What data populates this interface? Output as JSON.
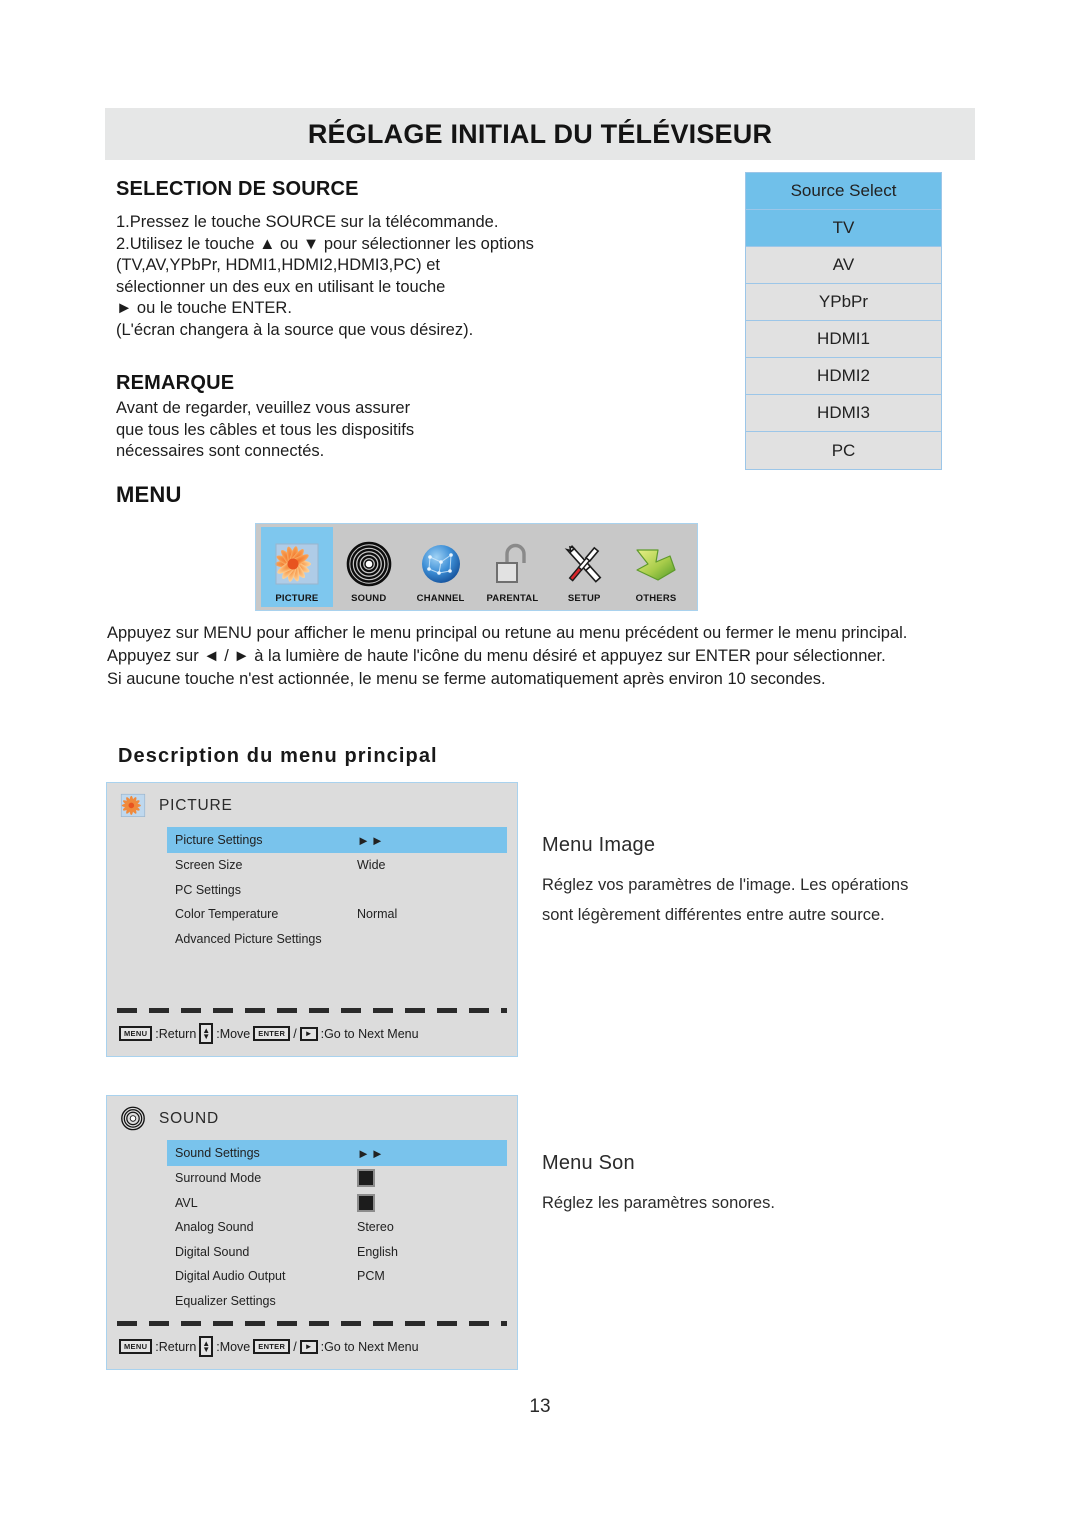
{
  "header": {
    "title": "RÉGLAGE INITIAL DU TÉLÉVISEUR"
  },
  "selection": {
    "heading": "SELECTION DE SOURCE",
    "body": "1.Pressez le touche SOURCE sur la télécommande.\n2.Utilisez le touche ▲ ou ▼ pour sélectionner les options\n(TV,AV,YPbPr, HDMI1,HDMI2,HDMI3,PC) et\nsélectionner un des eux en utilisant le touche\n► ou le touche ENTER.\n(L'écran changera à la source que vous désirez)."
  },
  "remarque": {
    "heading": "REMARQUE",
    "body": "Avant de regarder, veuillez vous assurer\nque tous les câbles et tous les dispositifs\nnécessaires sont connectés."
  },
  "source_select": {
    "title": "Source Select",
    "selected": "TV",
    "items": [
      {
        "label": "TV",
        "highlighted": true
      },
      {
        "label": "AV",
        "highlighted": false
      },
      {
        "label": "YPbPr",
        "highlighted": false
      },
      {
        "label": "HDMI1",
        "highlighted": false
      },
      {
        "label": "HDMI2",
        "highlighted": false
      },
      {
        "label": "HDMI3",
        "highlighted": false
      },
      {
        "label": "PC",
        "highlighted": false
      }
    ],
    "colors": {
      "highlight": "#70c0ea",
      "row": "#e1e1e1",
      "border": "#9cc6e8"
    }
  },
  "menu": {
    "heading": "MENU",
    "bar_items": [
      {
        "label": "PICTURE",
        "icon": "picture-icon",
        "selected": true
      },
      {
        "label": "SOUND",
        "icon": "sound-icon",
        "selected": false
      },
      {
        "label": "CHANNEL",
        "icon": "channel-icon",
        "selected": false
      },
      {
        "label": "PARENTAL",
        "icon": "parental-icon",
        "selected": false
      },
      {
        "label": "SETUP",
        "icon": "setup-icon",
        "selected": false
      },
      {
        "label": "OTHERS",
        "icon": "others-icon",
        "selected": false
      }
    ],
    "paragraph": "Appuyez sur MENU pour afficher le menu principal ou retune au menu précédent ou fermer le menu principal.\nAppuyez sur ◄ / ► à la lumière de haute l'icône du menu désiré et appuyez sur ENTER pour sélectionner.\nSi aucune touche n'est actionnée, le menu se ferme automatiquement après environ 10 secondes.",
    "description_heading": "Description du menu principal"
  },
  "osd_picture": {
    "icon": "picture-icon",
    "title": "PICTURE",
    "rows": [
      {
        "label": "Picture Settings",
        "value": "►►",
        "highlighted": true,
        "type": "arrows"
      },
      {
        "label": "Screen Size",
        "value": "Wide",
        "highlighted": false,
        "type": "text"
      },
      {
        "label": "PC Settings",
        "value": "",
        "highlighted": false,
        "type": "text"
      },
      {
        "label": "Color Temperature",
        "value": "Normal",
        "highlighted": false,
        "type": "text"
      },
      {
        "label": "Advanced Picture Settings",
        "value": "",
        "highlighted": false,
        "type": "text"
      }
    ],
    "footer": {
      "menu_key": "MENU",
      "return_text": ":Return",
      "move_text": ":Move",
      "enter_key": "ENTER",
      "slash": "/",
      "right_key": "►",
      "next_text": ":Go to Next Menu"
    }
  },
  "osd_sound": {
    "icon": "sound-icon",
    "title": "SOUND",
    "rows": [
      {
        "label": "Sound Settings",
        "value": "►►",
        "highlighted": true,
        "type": "arrows"
      },
      {
        "label": "Surround Mode",
        "value": "",
        "highlighted": false,
        "type": "checkbox"
      },
      {
        "label": "AVL",
        "value": "",
        "highlighted": false,
        "type": "checkbox"
      },
      {
        "label": "Analog Sound",
        "value": "Stereo",
        "highlighted": false,
        "type": "text"
      },
      {
        "label": "Digital Sound",
        "value": "English",
        "highlighted": false,
        "type": "text"
      },
      {
        "label": "Digital Audio Output",
        "value": "PCM",
        "highlighted": false,
        "type": "text"
      },
      {
        "label": "Equalizer Settings",
        "value": "",
        "highlighted": false,
        "type": "text"
      }
    ],
    "footer": {
      "menu_key": "MENU",
      "return_text": ":Return",
      "move_text": ":Move",
      "enter_key": "ENTER",
      "slash": "/",
      "right_key": "►",
      "next_text": ":Go to Next Menu"
    }
  },
  "desc_image": {
    "title": "Menu Image",
    "body": "Réglez vos paramètres de l'image. Les opérations\nsont légèrement différentes entre autre source."
  },
  "desc_sound": {
    "title": "Menu Son",
    "body": "Réglez les paramètres sonores."
  },
  "page_number": "13",
  "theme": {
    "header_band": "#e6e7e7",
    "osd_bg": "#dcdcdc",
    "osd_border": "#a9d2ee",
    "highlight_blue": "#79c3ec",
    "menubar_bg": "#c8c8c8"
  }
}
